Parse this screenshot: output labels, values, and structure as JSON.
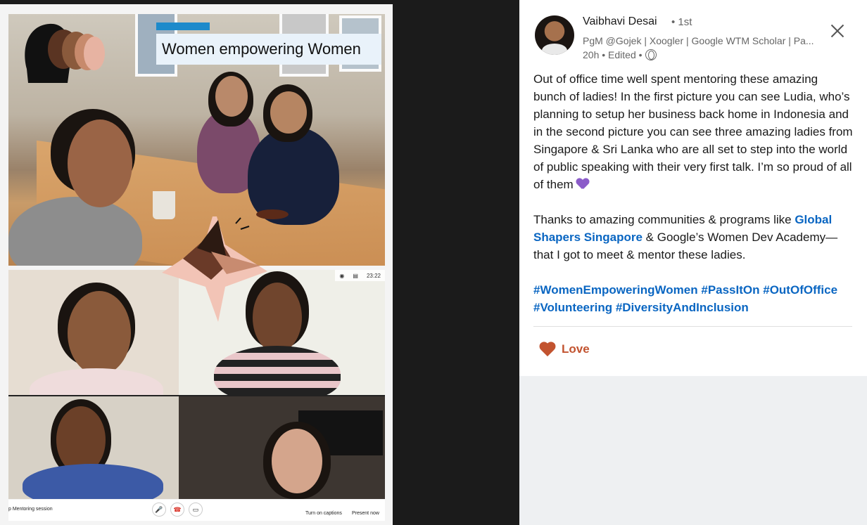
{
  "media": {
    "banner_text": "Women empowering Women",
    "call": {
      "time": "23:22",
      "meeting_name": "p Mentoring session",
      "captions_label": "Turn on captions",
      "present_label": "Present now"
    }
  },
  "post": {
    "author_name": "Vaibhavi Desai",
    "author_degree": "• 1st",
    "author_headline": "PgM @Gojek | Xoogler | Google WTM Scholar | Pa...",
    "timestamp": "20h • Edited •",
    "paragraph1": "Out of office time well spent mentoring these amazing bunch of ladies! In the first picture you can see Ludia, who’s planning to setup her business back home in Indonesia and in the second picture you can see three amazing ladies from Singapore & Sri Lanka who are all set to step into the world of public speaking with their very first talk. I’m so proud of all of them",
    "paragraph2_start": "Thanks to amazing communities & programs like ",
    "paragraph2_link": "Global Shapers Singapore",
    "paragraph2_end": " & Google’s Women Dev Academy— that I got to meet & mentor these ladies.",
    "hashtags": [
      "#WomenEmpoweringWomen",
      "#PassItOn",
      "#OutOfOffice",
      "#Volunteering",
      "#DiversityAndInclusion"
    ],
    "reaction_label": "Love"
  },
  "colors": {
    "link": "#0a66c2",
    "love": "#c2532f",
    "banner_accent": "#1d8acb"
  },
  "icons": [
    "globe-icon",
    "close-icon",
    "love-heart-icon",
    "purple-heart-emoji"
  ]
}
